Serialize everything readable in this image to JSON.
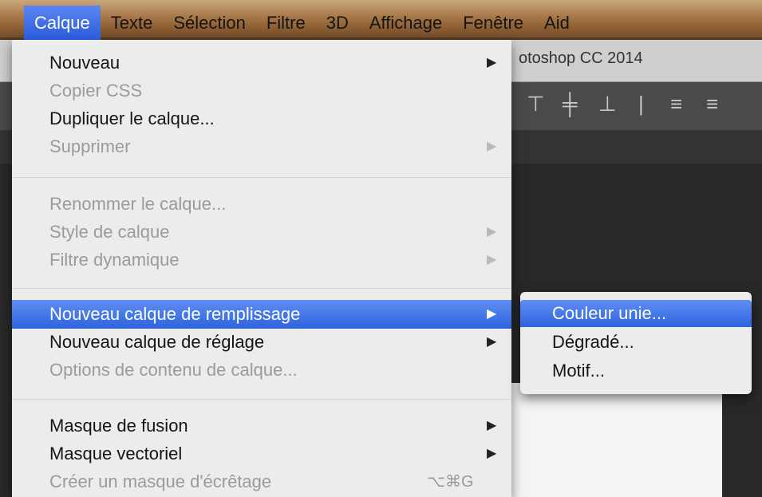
{
  "menubar": {
    "items": [
      "Calque",
      "Texte",
      "Sélection",
      "Filtre",
      "3D",
      "Affichage",
      "Fenêtre",
      "Aid"
    ]
  },
  "app": {
    "title": "otoshop CC 2014"
  },
  "menu": {
    "items": [
      {
        "label": "Nouveau",
        "arrow": "▶"
      },
      {
        "label": "Copier CSS"
      },
      {
        "label": "Dupliquer le calque..."
      },
      {
        "label": "Supprimer",
        "arrow": "▶"
      },
      {
        "label": "Renommer le calque..."
      },
      {
        "label": "Style de calque",
        "arrow": "▶"
      },
      {
        "label": "Filtre dynamique",
        "arrow": "▶"
      },
      {
        "label": "Nouveau calque de remplissage",
        "arrow": "▶"
      },
      {
        "label": "Nouveau calque de réglage",
        "arrow": "▶"
      },
      {
        "label": "Options de contenu de calque..."
      },
      {
        "label": "Masque de fusion",
        "arrow": "▶"
      },
      {
        "label": "Masque vectoriel",
        "arrow": "▶"
      },
      {
        "label": "Créer un masque d'écrêtage",
        "shortcut": "⌥⌘G"
      }
    ]
  },
  "submenu": {
    "items": [
      {
        "label": "Couleur unie..."
      },
      {
        "label": "Dégradé..."
      },
      {
        "label": "Motif..."
      }
    ]
  },
  "colors": {
    "highlight": "#3a6ee8",
    "menu_bg": "#ececec",
    "disabled_text": "#9b9b9b"
  }
}
